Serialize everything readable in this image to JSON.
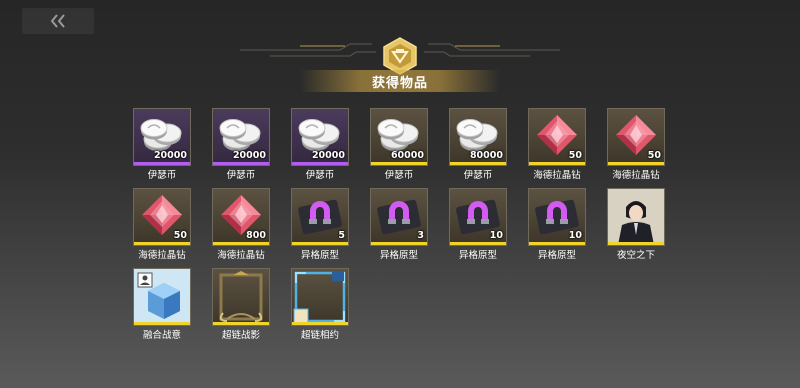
{
  "header": {
    "back_icon": "double-chevron-left-icon",
    "emblem_icon": "hexagon-emblem-icon",
    "title": "获得物品",
    "accent_color": "#d4aa46"
  },
  "items": [
    {
      "name": "伊瑟币",
      "qty": "20000",
      "rarity": "purple",
      "icon": "coin-stack-icon"
    },
    {
      "name": "伊瑟币",
      "qty": "20000",
      "rarity": "purple",
      "icon": "coin-stack-icon"
    },
    {
      "name": "伊瑟币",
      "qty": "20000",
      "rarity": "purple",
      "icon": "coin-stack-icon"
    },
    {
      "name": "伊瑟币",
      "qty": "60000",
      "rarity": "gold",
      "icon": "coin-stack-icon"
    },
    {
      "name": "伊瑟币",
      "qty": "80000",
      "rarity": "gold",
      "icon": "coin-stack-icon"
    },
    {
      "name": "海德拉晶钻",
      "qty": "50",
      "rarity": "gold",
      "icon": "pink-crystal-icon"
    },
    {
      "name": "海德拉晶钻",
      "qty": "50",
      "rarity": "gold",
      "icon": "pink-crystal-icon"
    },
    {
      "name": "海德拉晶钻",
      "qty": "50",
      "rarity": "gold",
      "icon": "pink-crystal-icon"
    },
    {
      "name": "海德拉晶钻",
      "qty": "800",
      "rarity": "gold",
      "icon": "pink-crystal-icon"
    },
    {
      "name": "异格原型",
      "qty": "5",
      "rarity": "gold",
      "icon": "magnet-device-icon"
    },
    {
      "name": "异格原型",
      "qty": "3",
      "rarity": "gold",
      "icon": "magnet-device-icon"
    },
    {
      "name": "异格原型",
      "qty": "10",
      "rarity": "gold",
      "icon": "magnet-device-icon"
    },
    {
      "name": "异格原型",
      "qty": "10",
      "rarity": "gold",
      "icon": "magnet-device-icon"
    },
    {
      "name": "夜空之下",
      "qty": "",
      "rarity": "gold",
      "icon": "character-portrait-icon"
    },
    {
      "name": "融合战意",
      "qty": "",
      "rarity": "gold",
      "icon": "blue-cube-icon"
    },
    {
      "name": "超链战影",
      "qty": "",
      "rarity": "gold",
      "icon": "ornate-frame-icon"
    },
    {
      "name": "超链相约",
      "qty": "",
      "rarity": "gold",
      "icon": "blue-frame-icon"
    }
  ]
}
